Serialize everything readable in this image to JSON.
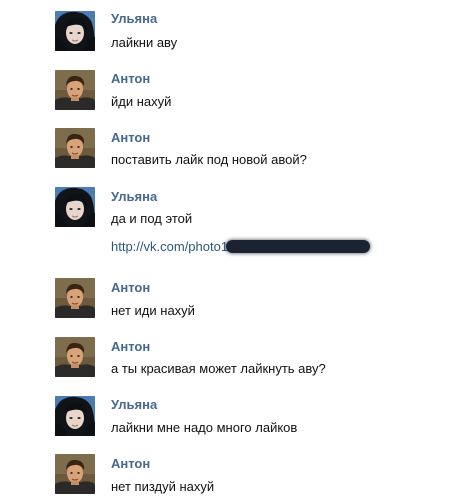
{
  "colors": {
    "author": "#45688e",
    "text": "#111111",
    "link": "#2b587a",
    "redaction": "#1b2330"
  },
  "messages": [
    {
      "author": "Ульяна",
      "text": "лайкни аву",
      "avatar": "avatar-ulyana"
    },
    {
      "author": "Антон",
      "text": "йди нахуй",
      "avatar": "avatar-anton"
    },
    {
      "author": "Антон",
      "text": "поставить лайк под новой авой?",
      "avatar": "avatar-anton"
    },
    {
      "author": "Ульяна",
      "text": "да и под этой",
      "avatar": "avatar-ulyana",
      "link": "http://vk.com/photo1"
    },
    {
      "author": "Антон",
      "text": "нет иди нахуй",
      "avatar": "avatar-anton"
    },
    {
      "author": "Антон",
      "text": "а ты красивая может лайкнуть аву?",
      "avatar": "avatar-anton"
    },
    {
      "author": "Ульяна",
      "text": "лайкни мне надо много лайков",
      "avatar": "avatar-ulyana"
    },
    {
      "author": "Антон",
      "text": "нет пиздуй нахуй",
      "avatar": "avatar-anton"
    }
  ]
}
